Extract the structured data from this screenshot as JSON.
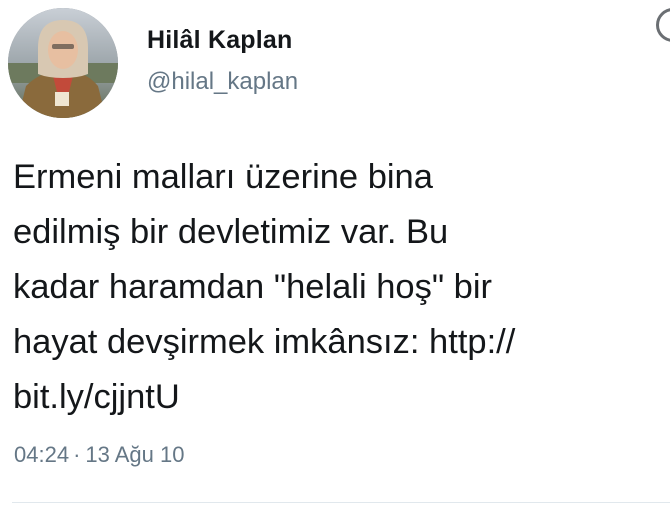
{
  "author": {
    "name": "Hilâl Kaplan",
    "handle": "@hilal_kaplan"
  },
  "tweet": {
    "lines": [
      "Ermeni malları üzerine bina",
      "edilmiş bir devletimiz var. Bu",
      "kadar haramdan \"helali hoş\" bir",
      "hayat devşirmek imkânsız: http://",
      "bit.ly/cjjntU"
    ],
    "time": "04:24",
    "separator": "·",
    "date": "13 Ağu 10"
  },
  "icons": {
    "avatar": "profile-photo",
    "corner": "circle-icon"
  },
  "colors": {
    "text": "#14171a",
    "secondary": "#657786",
    "divider": "#e1e8ed"
  }
}
